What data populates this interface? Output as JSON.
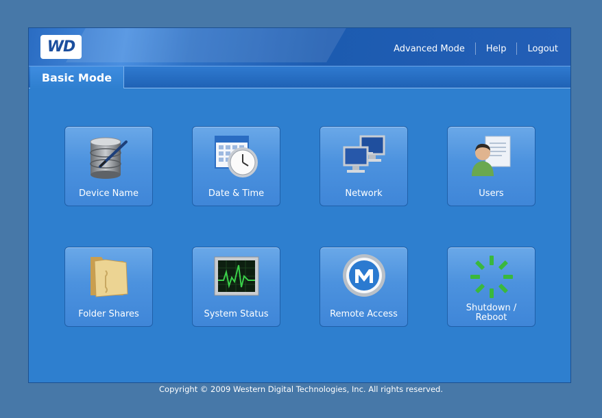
{
  "header": {
    "logo_text": "WD",
    "nav": {
      "advanced_mode": "Advanced Mode",
      "help": "Help",
      "logout": "Logout"
    }
  },
  "tabs": {
    "active": "Basic Mode"
  },
  "tiles": [
    {
      "label": "Device Name",
      "icon": "database-edit-icon"
    },
    {
      "label": "Date & Time",
      "icon": "calendar-clock-icon"
    },
    {
      "label": "Network",
      "icon": "network-computers-icon"
    },
    {
      "label": "Users",
      "icon": "user-icon"
    },
    {
      "label": "Folder Shares",
      "icon": "folder-icon"
    },
    {
      "label": "System Status",
      "icon": "monitor-status-icon"
    },
    {
      "label": "Remote Access",
      "icon": "remote-access-m-icon"
    },
    {
      "label": "Shutdown /\nReboot",
      "icon": "power-spinner-icon"
    }
  ],
  "footer": {
    "copyright": "Copyright © 2009 Western Digital Technologies, Inc. All rights reserved."
  },
  "colors": {
    "background": "#4778a8",
    "panel": "#2e7fcf",
    "tile": "#4c92de"
  }
}
